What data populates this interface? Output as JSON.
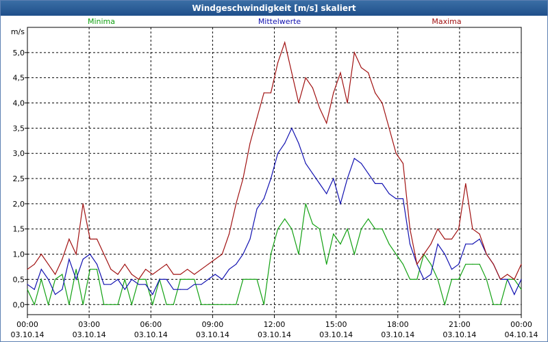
{
  "window": {
    "title": "Windgeschwindigkeit [m/s] skaliert"
  },
  "chart_data": {
    "type": "line",
    "title": "Windgeschwindigkeit [m/s] skaliert",
    "ylabel": "m/s",
    "ylim": [
      -0.2,
      5.5
    ],
    "yticks": [
      "0,0",
      "0,5",
      "1,0",
      "1,5",
      "2,0",
      "2,5",
      "3,0",
      "3,5",
      "4,0",
      "4,5",
      "5,0"
    ],
    "xticks": [
      {
        "time": "00:00",
        "date": "03.10.14"
      },
      {
        "time": "03:00",
        "date": "03.10.14"
      },
      {
        "time": "06:00",
        "date": "03.10.14"
      },
      {
        "time": "09:00",
        "date": "03.10.14"
      },
      {
        "time": "12:00",
        "date": "03.10.14"
      },
      {
        "time": "15:00",
        "date": "03.10.14"
      },
      {
        "time": "18:00",
        "date": "03.10.14"
      },
      {
        "time": "21:00",
        "date": "03.10.14"
      },
      {
        "time": "00:00",
        "date": "04.10.14"
      }
    ],
    "grid": true,
    "legend_position": "top",
    "x_start": "2014-10-03 00:00",
    "x_step_hours": 0.5,
    "series": [
      {
        "name": "Minima",
        "color": "#10a010",
        "values": [
          0.3,
          0.0,
          0.5,
          0.0,
          0.5,
          0.6,
          0.0,
          0.7,
          0.0,
          0.7,
          0.7,
          0.0,
          0.0,
          0.0,
          0.5,
          0.0,
          0.5,
          0.5,
          0.0,
          0.5,
          0.0,
          0.0,
          0.5,
          0.5,
          0.5,
          0.0,
          0.0,
          0.0,
          0.0,
          0.0,
          0.0,
          0.5,
          0.5,
          0.5,
          0.0,
          1.0,
          1.5,
          1.7,
          1.5,
          1.0,
          2.0,
          1.6,
          1.5,
          0.8,
          1.4,
          1.2,
          1.5,
          1.0,
          1.5,
          1.7,
          1.5,
          1.5,
          1.2,
          1.0,
          0.8,
          0.5,
          0.5,
          1.0,
          0.8,
          0.5,
          0.0,
          0.5,
          0.5,
          0.8,
          0.8,
          0.8,
          0.5,
          0.0,
          0.0,
          0.5,
          0.5,
          0.3
        ]
      },
      {
        "name": "Mittelwerte",
        "color": "#1010b0",
        "values": [
          0.4,
          0.3,
          0.7,
          0.5,
          0.2,
          0.3,
          0.9,
          0.5,
          0.9,
          1.0,
          0.8,
          0.4,
          0.4,
          0.5,
          0.3,
          0.5,
          0.4,
          0.4,
          0.2,
          0.5,
          0.5,
          0.3,
          0.3,
          0.3,
          0.4,
          0.4,
          0.5,
          0.6,
          0.5,
          0.7,
          0.8,
          1.0,
          1.3,
          1.9,
          2.1,
          2.5,
          3.0,
          3.2,
          3.5,
          3.2,
          2.8,
          2.6,
          2.4,
          2.2,
          2.5,
          2.0,
          2.5,
          2.9,
          2.8,
          2.6,
          2.4,
          2.4,
          2.2,
          2.1,
          2.1,
          1.2,
          0.8,
          0.5,
          0.6,
          1.2,
          1.0,
          0.7,
          0.8,
          1.2,
          1.2,
          1.3,
          1.0,
          0.8,
          0.5,
          0.5,
          0.2,
          0.5
        ]
      },
      {
        "name": "Maxima",
        "color": "#a01010",
        "values": [
          0.7,
          0.8,
          1.0,
          0.8,
          0.6,
          0.9,
          1.3,
          1.0,
          2.0,
          1.3,
          1.3,
          1.0,
          0.7,
          0.6,
          0.8,
          0.6,
          0.5,
          0.7,
          0.6,
          0.7,
          0.8,
          0.6,
          0.6,
          0.7,
          0.6,
          0.7,
          0.8,
          0.9,
          1.0,
          1.4,
          2.0,
          2.5,
          3.2,
          3.7,
          4.2,
          4.2,
          4.8,
          5.2,
          4.6,
          4.0,
          4.5,
          4.3,
          3.9,
          3.6,
          4.2,
          4.6,
          4.0,
          5.0,
          4.7,
          4.6,
          4.2,
          4.0,
          3.5,
          3.0,
          2.8,
          1.5,
          0.8,
          1.0,
          1.2,
          1.5,
          1.3,
          1.3,
          1.5,
          2.4,
          1.5,
          1.4,
          1.0,
          0.8,
          0.5,
          0.6,
          0.5,
          0.8
        ]
      }
    ]
  }
}
